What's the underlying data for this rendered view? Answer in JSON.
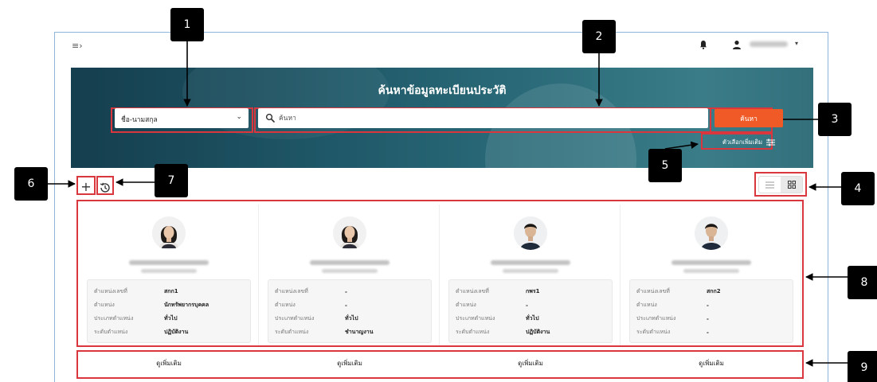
{
  "header": {
    "menu_icon": "collapse-menu-icon",
    "notification_icon": "bell-icon",
    "user_icon": "user-icon",
    "user_menu_caret": "▾"
  },
  "hero": {
    "title": "ค้นหาข้อมูลทะเบียนประวัติ",
    "select_value": "ชื่อ-นามสกุล",
    "search_placeholder": "ค้นหา",
    "search_button": "ค้นหา",
    "more_options": "ตัวเลือกเพิ่มเติม"
  },
  "toolbar": {
    "add_label": "+",
    "history_icon": "history-icon",
    "view_list_icon": "list-view-icon",
    "view_grid_icon": "grid-view-icon"
  },
  "cards": [
    {
      "avatar": "woman-portrait",
      "fields": [
        {
          "label": "ตำแหน่งเลขที่",
          "value": "สกก1"
        },
        {
          "label": "ตำแหน่ง",
          "value": "นักทรัพยากรบุคคล"
        },
        {
          "label": "ประเภทตำแหน่ง",
          "value": "ทั่วไป"
        },
        {
          "label": "ระดับตำแหน่ง",
          "value": "ปฏิบัติงาน"
        }
      ],
      "more": "ดูเพิ่มเติม"
    },
    {
      "avatar": "woman-portrait",
      "fields": [
        {
          "label": "ตำแหน่งเลขที่",
          "value": "-"
        },
        {
          "label": "ตำแหน่ง",
          "value": "-"
        },
        {
          "label": "ประเภทตำแหน่ง",
          "value": "ทั่วไป"
        },
        {
          "label": "ระดับตำแหน่ง",
          "value": "ชำนาญงาน"
        }
      ],
      "more": "ดูเพิ่มเติม"
    },
    {
      "avatar": "man-portrait",
      "fields": [
        {
          "label": "ตำแหน่งเลขที่",
          "value": "กพร1"
        },
        {
          "label": "ตำแหน่ง",
          "value": "-"
        },
        {
          "label": "ประเภทตำแหน่ง",
          "value": "ทั่วไป"
        },
        {
          "label": "ระดับตำแหน่ง",
          "value": "ปฏิบัติงาน"
        }
      ],
      "more": "ดูเพิ่มเติม"
    },
    {
      "avatar": "man-portrait",
      "fields": [
        {
          "label": "ตำแหน่งเลขที่",
          "value": "สกก2"
        },
        {
          "label": "ตำแหน่ง",
          "value": "-"
        },
        {
          "label": "ประเภทตำแหน่ง",
          "value": "-"
        },
        {
          "label": "ระดับตำแหน่ง",
          "value": "-"
        }
      ],
      "more": "ดูเพิ่มเติม"
    }
  ],
  "callouts": [
    "1",
    "2",
    "3",
    "4",
    "5",
    "6",
    "7",
    "8",
    "9"
  ],
  "colors": {
    "accent": "#ef5a26",
    "highlight": "#d9363e",
    "hero": "#1f5868",
    "frame": "#8fb4d9"
  }
}
